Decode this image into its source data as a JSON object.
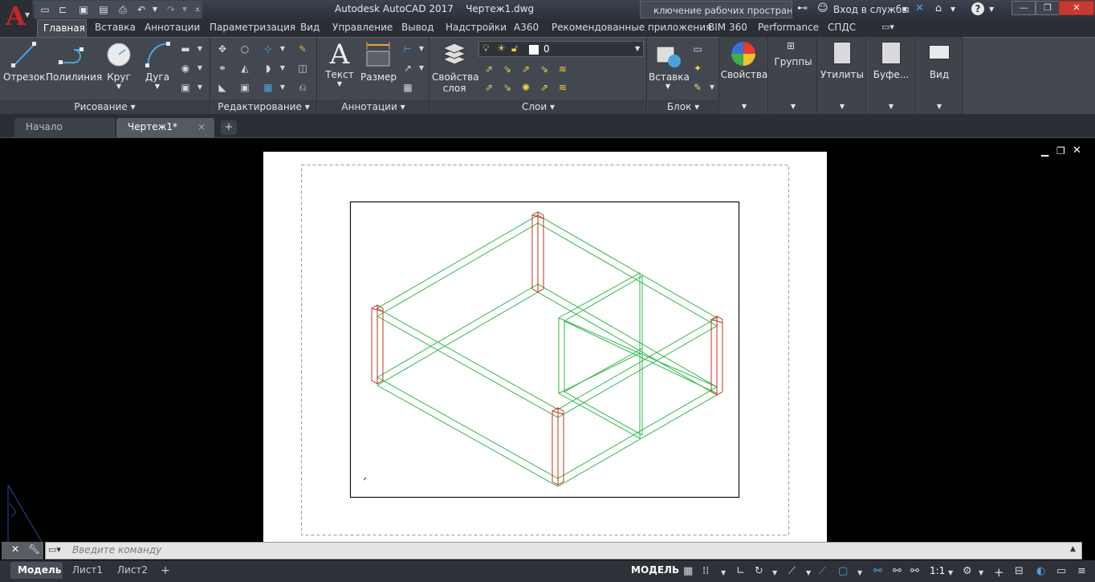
{
  "app": {
    "title": "Autodesk AutoCAD 2017    Чертеж1.dwg",
    "logo_letter": "A",
    "workspace_text": "ключение рабочих пространств",
    "signin_label": "Вход в службы",
    "help_label": "?"
  },
  "colors": {
    "accent": "#c8242a",
    "titlebar": "#2e343d",
    "ribbon": "#434850",
    "canvas": "#000000",
    "paper": "#ffffff",
    "model_lines": "#2db84a",
    "column_lines": "#c8321e"
  },
  "quick_access": [
    "new-icon",
    "open-icon",
    "save-icon",
    "saveas-icon",
    "print-icon",
    "undo-icon",
    "redo-icon",
    "dropdown-icon"
  ],
  "ribbon_tabs": [
    "Главная",
    "Вставка",
    "Аннотации",
    "Параметризация",
    "Вид",
    "Управление",
    "Вывод",
    "Надстройки",
    "А360",
    "Рекомендованные приложения",
    "BIM 360",
    "Performance",
    "СПДС"
  ],
  "panels": {
    "draw": {
      "title": "Рисование",
      "tools": [
        "Отрезок",
        "Полилиния",
        "Круг",
        "Дуга"
      ]
    },
    "modify": {
      "title": "Редактирование"
    },
    "annotation": {
      "title": "Аннотации",
      "tools": [
        "Текст",
        "Размер"
      ]
    },
    "layers": {
      "title": "Слои",
      "layer_props": "Свойства слоя",
      "current_layer": "0"
    },
    "block": {
      "title": "Блок",
      "tools": [
        "Вставка"
      ]
    },
    "properties": {
      "label": "Свойства"
    },
    "groups": {
      "label": "Группы"
    },
    "utilities": {
      "label": "Утилиты"
    },
    "clipboard": {
      "label": "Буфе..."
    },
    "view": {
      "label": "Вид"
    }
  },
  "doc_tabs": {
    "start": "Начало",
    "drawing": "Чертеж1*",
    "close": "×",
    "add": "+"
  },
  "command": {
    "placeholder": "Введите команду"
  },
  "status": {
    "tabs": [
      "Модель",
      "Лист1",
      "Лист2"
    ],
    "model_label": "МОДЕЛЬ",
    "scale": "1:1"
  }
}
